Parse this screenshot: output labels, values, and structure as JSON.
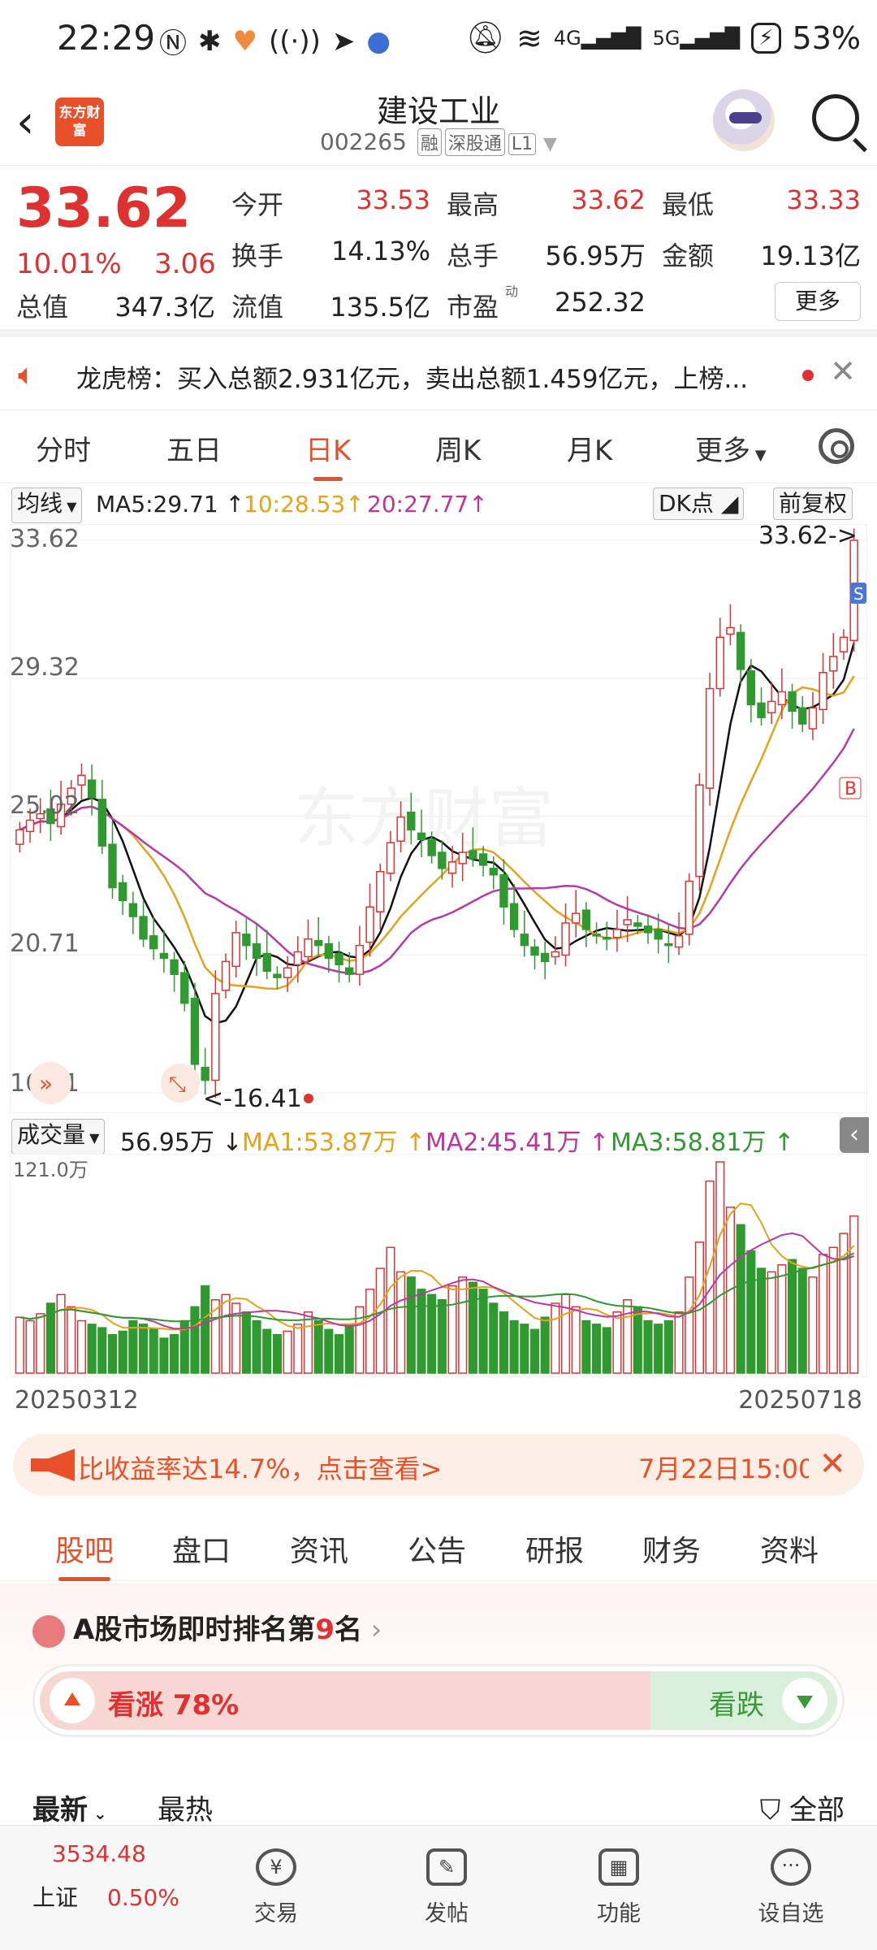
{
  "status_bar": {
    "time": "22:29",
    "battery": "53%",
    "net1": "4G",
    "net2": "5G"
  },
  "header": {
    "back_icon": "chevron-left-icon",
    "logo_text": "东方财富",
    "title": "建设工业",
    "code": "002265",
    "tags": [
      "融",
      "深股通",
      "L1"
    ]
  },
  "quote": {
    "price": "33.62",
    "change_pct": "10.01%",
    "change": "3.06",
    "fields": [
      {
        "label": "今开",
        "value": "33.53",
        "red": true
      },
      {
        "label": "最高",
        "value": "33.62",
        "red": true
      },
      {
        "label": "最低",
        "value": "33.33",
        "red": true
      },
      {
        "label": "换手",
        "value": "14.13%",
        "red": false
      },
      {
        "label": "总手",
        "value": "56.95万",
        "red": false
      },
      {
        "label": "金额",
        "value": "19.13亿",
        "red": false
      },
      {
        "label": "总值",
        "value": "347.3亿",
        "red": false
      },
      {
        "label": "流值",
        "value": "135.5亿",
        "red": false
      },
      {
        "label": "市盈",
        "value": "252.32",
        "red": false
      }
    ],
    "pe_mark": "动",
    "more": "更多"
  },
  "dragon": {
    "text": "龙虎榜：买入总额2.931亿元，卖出总额1.459亿元，上榜..."
  },
  "period_tabs": [
    "分时",
    "五日",
    "日K",
    "周K",
    "月K",
    "更多"
  ],
  "active_period": "日K",
  "ma_row": {
    "selector": "均线",
    "ma5": "MA5:29.71",
    "ma10": "10:28.53",
    "ma20": "20:27.77",
    "dk": "DK点",
    "adjust": "前复权"
  },
  "kline": {
    "y_labels": [
      "33.62",
      "29.32",
      "25.02",
      "20.71",
      "16.41"
    ],
    "last_label": "33.62->",
    "low_label": "<-16.41",
    "s_marker": "S",
    "b_marker": "B",
    "watermark": "东方财富"
  },
  "volume_row": {
    "selector": "成交量",
    "vol": "56.95万",
    "ma1": "MA1:53.87万",
    "ma2": "MA2:45.41万",
    "ma3": "MA3:58.81万",
    "axis_max": "121.0万"
  },
  "dates": {
    "start": "20250312",
    "end": "20250718"
  },
  "promo": {
    "text": "比收益率达14.7%，点击查看>",
    "date": "7月22日15:00"
  },
  "info_tabs": [
    "股吧",
    "盘口",
    "资讯",
    "公告",
    "研报",
    "财务",
    "资料"
  ],
  "active_info_tab": "股吧",
  "rank": {
    "prefix": "A股市场即时排名第",
    "num": "9",
    "suffix": "名"
  },
  "vote": {
    "up": "看涨 78%",
    "down": "看跌"
  },
  "sort": {
    "latest": "最新",
    "hot": "最热",
    "filter": "全部"
  },
  "bottom_nav": {
    "index_value": "3534.48",
    "index_name": "上证",
    "index_change": "0.50%",
    "items": [
      "交易",
      "发帖",
      "功能",
      "设自选"
    ]
  },
  "chart_data": {
    "type": "candlestick",
    "x_range": [
      "20250312",
      "20250718"
    ],
    "y_range": [
      16.41,
      33.62
    ],
    "current": 33.62,
    "period_low": 16.41,
    "close_series": [
      24.6,
      24.9,
      25.1,
      24.8,
      25.4,
      25.9,
      26.3,
      25.6,
      24.1,
      22.8,
      22.4,
      21.9,
      21.2,
      20.9,
      20.6,
      20.1,
      19.2,
      17.3,
      16.8,
      19.5,
      20.5,
      21.4,
      21.0,
      20.6,
      20.2,
      20.0,
      20.3,
      20.8,
      21.2,
      21.0,
      20.6,
      20.4,
      20.1,
      21.0,
      22.2,
      23.3,
      24.2,
      25.0,
      24.6,
      24.3,
      23.8,
      23.4,
      23.6,
      23.9,
      23.7,
      23.5,
      23.2,
      22.2,
      21.5,
      21.0,
      20.7,
      20.5,
      20.8,
      21.7,
      22.0,
      21.5,
      21.3,
      21.2,
      21.5,
      21.8,
      21.6,
      21.4,
      21.2,
      21.0,
      21.3,
      23.0,
      26.0,
      29.0,
      30.6,
      30.9,
      29.6,
      28.5,
      28.1,
      28.6,
      28.9,
      28.3,
      27.9,
      28.4,
      29.5,
      30.0,
      30.6,
      33.62
    ],
    "volume_series": [
      32,
      30,
      34,
      40,
      45,
      38,
      30,
      28,
      26,
      22,
      24,
      30,
      28,
      25,
      20,
      22,
      30,
      38,
      50,
      42,
      45,
      40,
      35,
      30,
      25,
      22,
      24,
      28,
      35,
      30,
      25,
      22,
      28,
      38,
      48,
      60,
      72,
      58,
      55,
      48,
      45,
      42,
      50,
      55,
      52,
      48,
      40,
      35,
      30,
      28,
      25,
      32,
      40,
      45,
      38,
      30,
      28,
      26,
      35,
      42,
      38,
      30,
      28,
      30,
      35,
      55,
      75,
      110,
      121,
      95,
      85,
      70,
      60,
      58,
      62,
      65,
      60,
      55,
      68,
      72,
      80,
      90
    ],
    "ma_volume": {
      "MA1": 53.87,
      "MA2": 45.41,
      "MA3": 58.81
    },
    "ma_price": {
      "MA5": 29.71,
      "MA10": 28.53,
      "MA20": 27.77
    }
  }
}
